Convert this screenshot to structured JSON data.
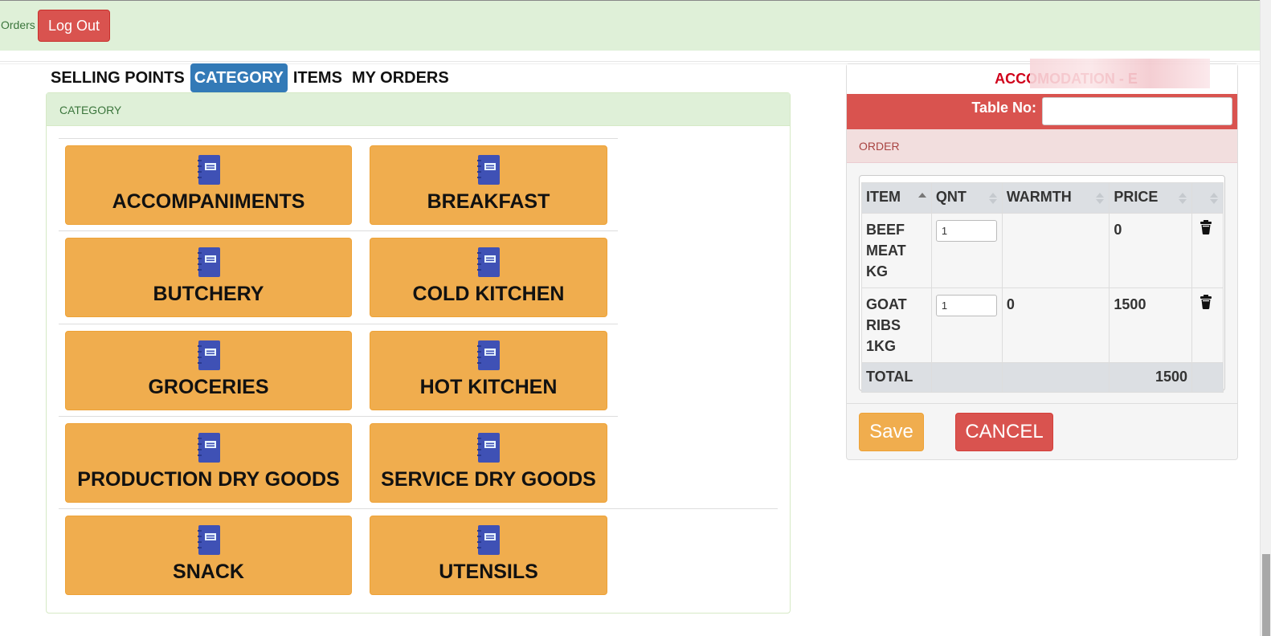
{
  "topbar": {
    "orders_link": "Orders",
    "logout_label": "Log Out"
  },
  "tabs": [
    {
      "label": "SELLING POINTS",
      "active": false
    },
    {
      "label": "CATEGORY",
      "active": true
    },
    {
      "label": "ITEMS",
      "active": false
    },
    {
      "label": "MY ORDERS",
      "active": false
    }
  ],
  "category_panel": {
    "heading": "CATEGORY",
    "categories": [
      "ACCOMPANIMENTS",
      "BREAKFAST",
      "BUTCHERY",
      "COLD KITCHEN",
      "GROCERIES",
      "HOT KITCHEN",
      "PRODUCTION DRY GOODS",
      "SERVICE DRY GOODS",
      "SNACK",
      "UTENSILS"
    ],
    "icon": "notebook-icon"
  },
  "order_panel": {
    "title": "ACCOMODATION - E",
    "table_no_label": "Table No:",
    "table_no_value": "",
    "order_heading": "ORDER",
    "columns": [
      "ITEM",
      "QNT",
      "WARMTH",
      "PRICE",
      ""
    ],
    "rows": [
      {
        "item": "BEEF MEAT KG",
        "qnt": "1",
        "warmth": "",
        "price": "0"
      },
      {
        "item": "GOAT RIBS 1KG",
        "qnt": "1",
        "warmth": "0",
        "price": "1500"
      }
    ],
    "total_label": "TOTAL",
    "total_value": "1500",
    "save_label": "Save",
    "cancel_label": "CANCEL"
  },
  "colors": {
    "topbar_bg": "#dff0d8",
    "danger": "#d9534f",
    "warning": "#f0ad4e",
    "primary": "#337ab7",
    "icon_blue": "#3f51b5"
  }
}
